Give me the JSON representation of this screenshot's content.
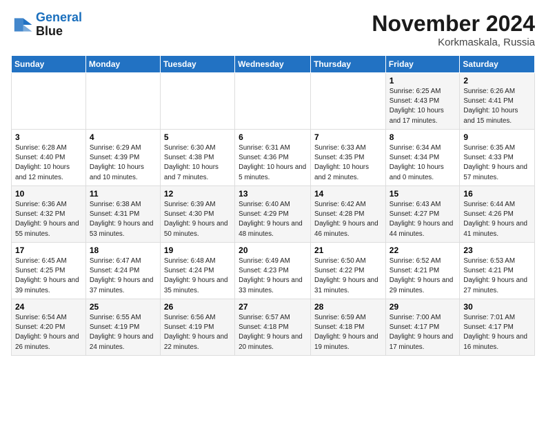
{
  "header": {
    "logo_line1": "General",
    "logo_line2": "Blue",
    "month": "November 2024",
    "location": "Korkmaskala, Russia"
  },
  "weekdays": [
    "Sunday",
    "Monday",
    "Tuesday",
    "Wednesday",
    "Thursday",
    "Friday",
    "Saturday"
  ],
  "weeks": [
    [
      {
        "day": "",
        "info": ""
      },
      {
        "day": "",
        "info": ""
      },
      {
        "day": "",
        "info": ""
      },
      {
        "day": "",
        "info": ""
      },
      {
        "day": "",
        "info": ""
      },
      {
        "day": "1",
        "info": "Sunrise: 6:25 AM\nSunset: 4:43 PM\nDaylight: 10 hours\nand 17 minutes."
      },
      {
        "day": "2",
        "info": "Sunrise: 6:26 AM\nSunset: 4:41 PM\nDaylight: 10 hours\nand 15 minutes."
      }
    ],
    [
      {
        "day": "3",
        "info": "Sunrise: 6:28 AM\nSunset: 4:40 PM\nDaylight: 10 hours\nand 12 minutes."
      },
      {
        "day": "4",
        "info": "Sunrise: 6:29 AM\nSunset: 4:39 PM\nDaylight: 10 hours\nand 10 minutes."
      },
      {
        "day": "5",
        "info": "Sunrise: 6:30 AM\nSunset: 4:38 PM\nDaylight: 10 hours\nand 7 minutes."
      },
      {
        "day": "6",
        "info": "Sunrise: 6:31 AM\nSunset: 4:36 PM\nDaylight: 10 hours\nand 5 minutes."
      },
      {
        "day": "7",
        "info": "Sunrise: 6:33 AM\nSunset: 4:35 PM\nDaylight: 10 hours\nand 2 minutes."
      },
      {
        "day": "8",
        "info": "Sunrise: 6:34 AM\nSunset: 4:34 PM\nDaylight: 10 hours\nand 0 minutes."
      },
      {
        "day": "9",
        "info": "Sunrise: 6:35 AM\nSunset: 4:33 PM\nDaylight: 9 hours\nand 57 minutes."
      }
    ],
    [
      {
        "day": "10",
        "info": "Sunrise: 6:36 AM\nSunset: 4:32 PM\nDaylight: 9 hours\nand 55 minutes."
      },
      {
        "day": "11",
        "info": "Sunrise: 6:38 AM\nSunset: 4:31 PM\nDaylight: 9 hours\nand 53 minutes."
      },
      {
        "day": "12",
        "info": "Sunrise: 6:39 AM\nSunset: 4:30 PM\nDaylight: 9 hours\nand 50 minutes."
      },
      {
        "day": "13",
        "info": "Sunrise: 6:40 AM\nSunset: 4:29 PM\nDaylight: 9 hours\nand 48 minutes."
      },
      {
        "day": "14",
        "info": "Sunrise: 6:42 AM\nSunset: 4:28 PM\nDaylight: 9 hours\nand 46 minutes."
      },
      {
        "day": "15",
        "info": "Sunrise: 6:43 AM\nSunset: 4:27 PM\nDaylight: 9 hours\nand 44 minutes."
      },
      {
        "day": "16",
        "info": "Sunrise: 6:44 AM\nSunset: 4:26 PM\nDaylight: 9 hours\nand 41 minutes."
      }
    ],
    [
      {
        "day": "17",
        "info": "Sunrise: 6:45 AM\nSunset: 4:25 PM\nDaylight: 9 hours\nand 39 minutes."
      },
      {
        "day": "18",
        "info": "Sunrise: 6:47 AM\nSunset: 4:24 PM\nDaylight: 9 hours\nand 37 minutes."
      },
      {
        "day": "19",
        "info": "Sunrise: 6:48 AM\nSunset: 4:24 PM\nDaylight: 9 hours\nand 35 minutes."
      },
      {
        "day": "20",
        "info": "Sunrise: 6:49 AM\nSunset: 4:23 PM\nDaylight: 9 hours\nand 33 minutes."
      },
      {
        "day": "21",
        "info": "Sunrise: 6:50 AM\nSunset: 4:22 PM\nDaylight: 9 hours\nand 31 minutes."
      },
      {
        "day": "22",
        "info": "Sunrise: 6:52 AM\nSunset: 4:21 PM\nDaylight: 9 hours\nand 29 minutes."
      },
      {
        "day": "23",
        "info": "Sunrise: 6:53 AM\nSunset: 4:21 PM\nDaylight: 9 hours\nand 27 minutes."
      }
    ],
    [
      {
        "day": "24",
        "info": "Sunrise: 6:54 AM\nSunset: 4:20 PM\nDaylight: 9 hours\nand 26 minutes."
      },
      {
        "day": "25",
        "info": "Sunrise: 6:55 AM\nSunset: 4:19 PM\nDaylight: 9 hours\nand 24 minutes."
      },
      {
        "day": "26",
        "info": "Sunrise: 6:56 AM\nSunset: 4:19 PM\nDaylight: 9 hours\nand 22 minutes."
      },
      {
        "day": "27",
        "info": "Sunrise: 6:57 AM\nSunset: 4:18 PM\nDaylight: 9 hours\nand 20 minutes."
      },
      {
        "day": "28",
        "info": "Sunrise: 6:59 AM\nSunset: 4:18 PM\nDaylight: 9 hours\nand 19 minutes."
      },
      {
        "day": "29",
        "info": "Sunrise: 7:00 AM\nSunset: 4:17 PM\nDaylight: 9 hours\nand 17 minutes."
      },
      {
        "day": "30",
        "info": "Sunrise: 7:01 AM\nSunset: 4:17 PM\nDaylight: 9 hours\nand 16 minutes."
      }
    ]
  ]
}
